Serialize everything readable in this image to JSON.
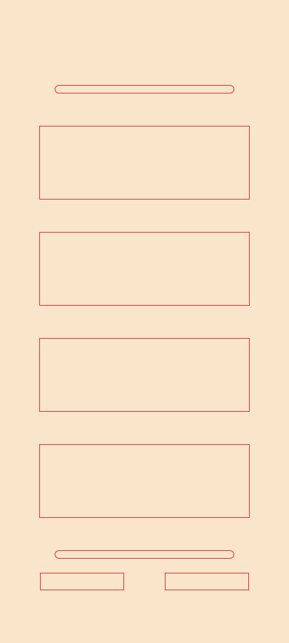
{
  "colors": {
    "background": "#f9e5c9",
    "outline": "#e03232"
  },
  "top_bar": {
    "label": ""
  },
  "cards": [
    {
      "label": ""
    },
    {
      "label": ""
    },
    {
      "label": ""
    },
    {
      "label": ""
    }
  ],
  "bottom_bar": {
    "label": ""
  },
  "left_button": {
    "label": ""
  },
  "right_button": {
    "label": ""
  }
}
